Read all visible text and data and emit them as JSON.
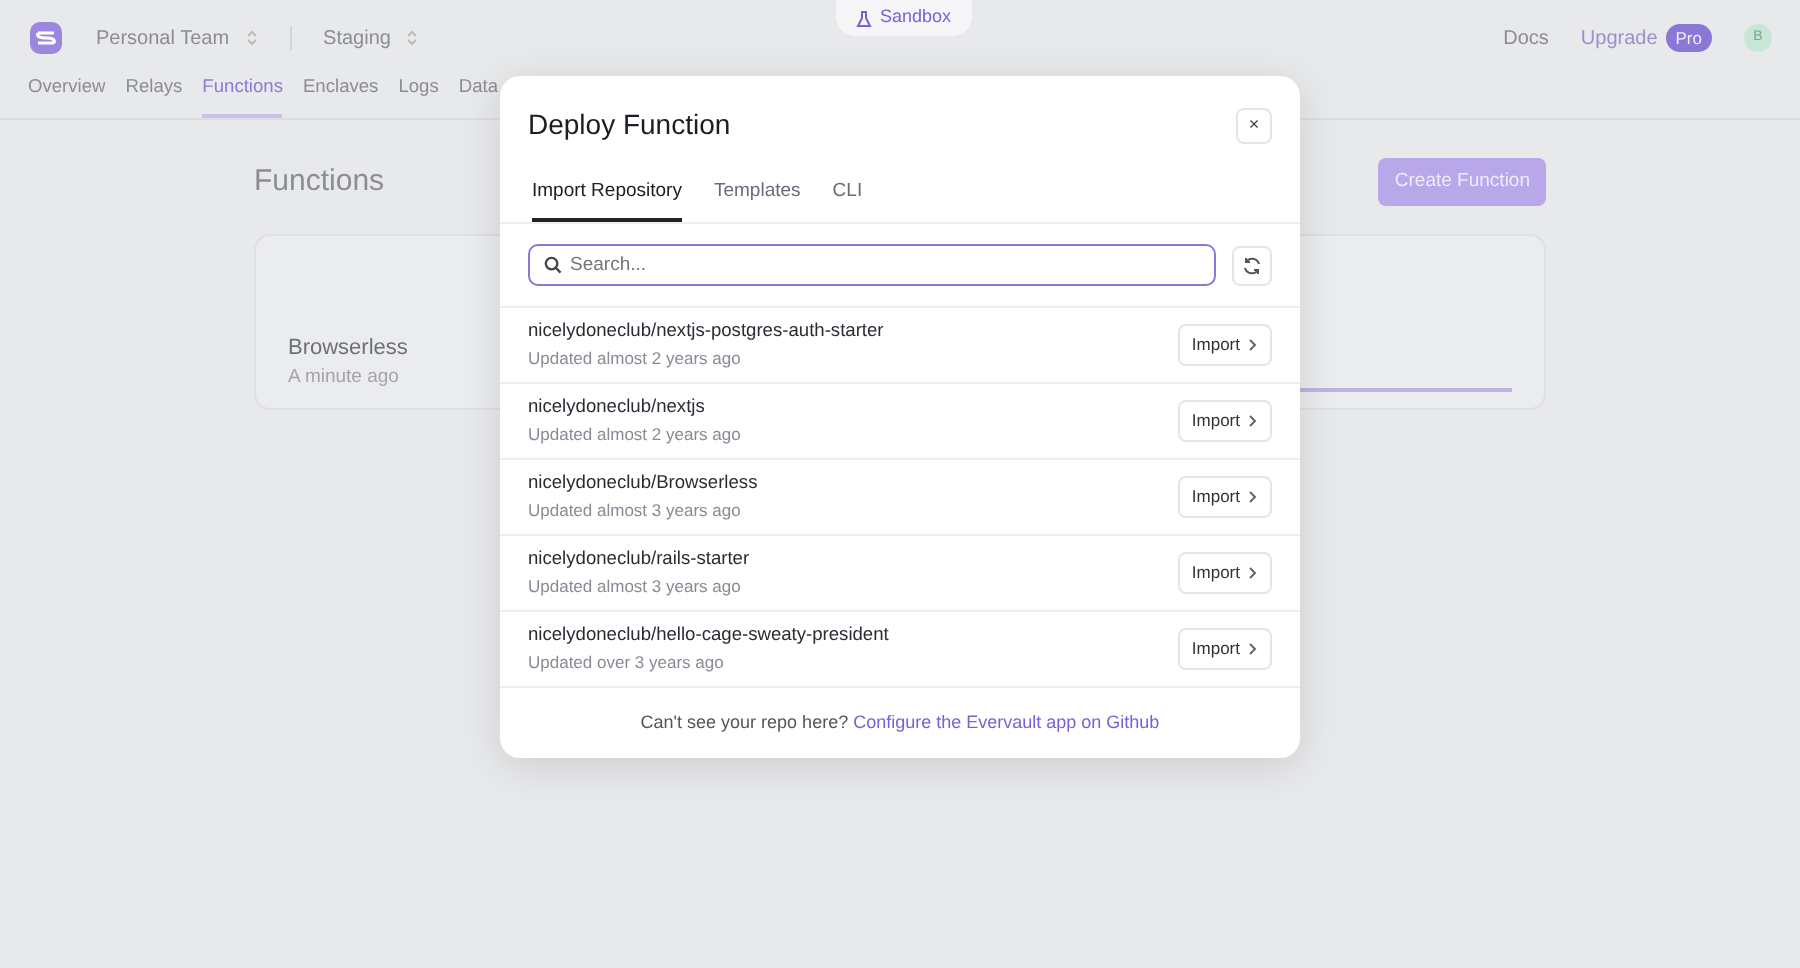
{
  "environment_tab": {
    "label": "Sandbox"
  },
  "header": {
    "team": "Personal Team",
    "environment": "Staging",
    "docs": "Docs",
    "upgrade": "Upgrade",
    "plan_badge": "Pro",
    "avatar": "B"
  },
  "nav": [
    {
      "label": "Overview",
      "selected": false
    },
    {
      "label": "Relays",
      "selected": false
    },
    {
      "label": "Functions",
      "selected": true
    },
    {
      "label": "Enclaves",
      "selected": false
    },
    {
      "label": "Logs",
      "selected": false
    },
    {
      "label": "Data",
      "selected": false
    }
  ],
  "page": {
    "title": "Functions",
    "create_button": "Create Function",
    "functions": [
      {
        "name": "Browserless",
        "updated": "A minute ago"
      }
    ]
  },
  "modal": {
    "title": "Deploy Function",
    "close": "×",
    "tabs": [
      {
        "label": "Import Repository",
        "selected": true
      },
      {
        "label": "Templates",
        "selected": false
      },
      {
        "label": "CLI",
        "selected": false
      }
    ],
    "search": {
      "placeholder": "Search..."
    },
    "repos": [
      {
        "name": "nicelydoneclub/nextjs-postgres-auth-starter",
        "updated": "Updated almost 2 years ago",
        "action": "Import"
      },
      {
        "name": "nicelydoneclub/nextjs",
        "updated": "Updated almost 2 years ago",
        "action": "Import"
      },
      {
        "name": "nicelydoneclub/Browserless",
        "updated": "Updated almost 3 years ago",
        "action": "Import"
      },
      {
        "name": "nicelydoneclub/rails-starter",
        "updated": "Updated almost 3 years ago",
        "action": "Import"
      },
      {
        "name": "nicelydoneclub/hello-cage-sweaty-president",
        "updated": "Updated over 3 years ago",
        "action": "Import"
      }
    ],
    "footer_text": "Can't see your repo here?",
    "footer_link": "Configure the Evervault app on Github"
  }
}
